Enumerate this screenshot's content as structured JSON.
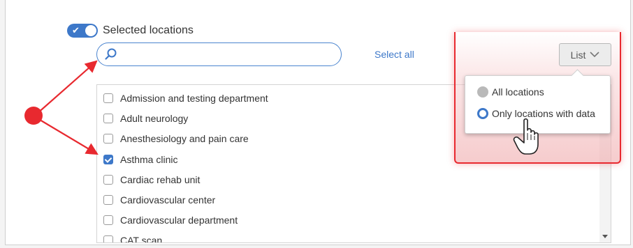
{
  "toggle": {
    "label": "Selected locations",
    "state": "on"
  },
  "search": {
    "value": "",
    "placeholder": ""
  },
  "select_all_label": "Select all",
  "list_button_label": "List",
  "dropdown": {
    "options": [
      {
        "label": "All locations",
        "selected": false
      },
      {
        "label": "Only locations with data",
        "selected": true
      }
    ]
  },
  "locations": [
    {
      "label": "Admission and testing department",
      "checked": false
    },
    {
      "label": "Adult neurology",
      "checked": false
    },
    {
      "label": "Anesthesiology and pain care",
      "checked": false
    },
    {
      "label": "Asthma clinic",
      "checked": true
    },
    {
      "label": "Cardiac rehab unit",
      "checked": false
    },
    {
      "label": "Cardiovascular center",
      "checked": false
    },
    {
      "label": "Cardiovascular department",
      "checked": false
    },
    {
      "label": "CAT scan",
      "checked": false
    }
  ],
  "colors": {
    "accent": "#3d78c9",
    "annotation": "#e8292f"
  }
}
